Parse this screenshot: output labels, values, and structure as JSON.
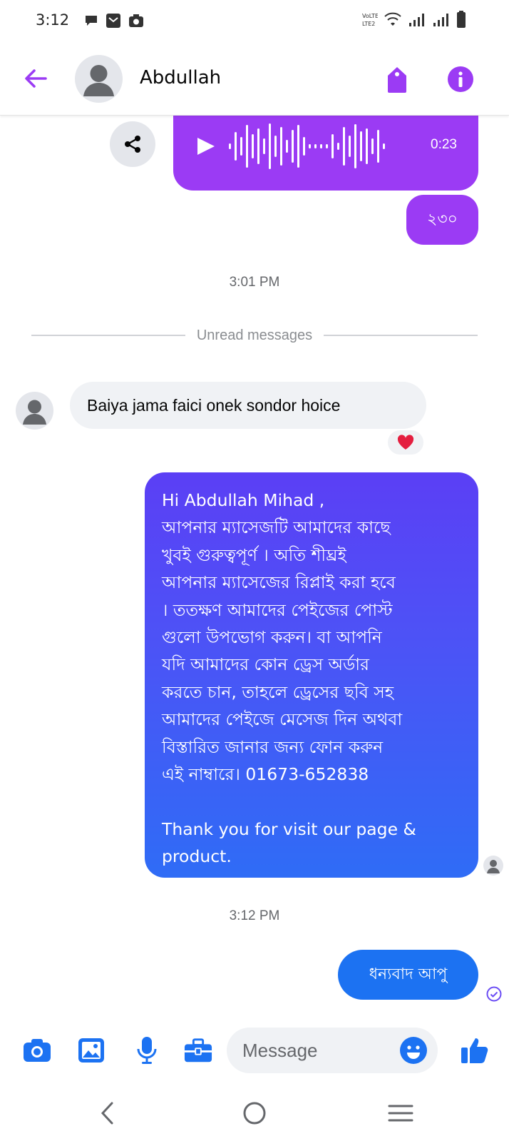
{
  "status_bar": {
    "time": "3:12"
  },
  "header": {
    "contact_name": "Abdullah"
  },
  "messages": {
    "audio": {
      "duration": "0:23"
    },
    "outgoing_short": "২৩০",
    "timestamp_1": "3:01 PM",
    "unread_label": "Unread messages",
    "incoming_text": "Baiya jama faici onek sondor hoice",
    "reaction": "❤️",
    "auto_reply_lines": [
      "Hi Abdullah Mihad ,",
      "আপনার ম্যাসেজটি আমাদের কাছে",
      "খুবই গুরুত্বপূর্ণ । অতি শীঘ্রই",
      "আপনার ম্যাসেজের রিপ্লাই করা হবে",
      "। ততক্ষণ আমাদের পেইজের পোস্ট",
      "গুলো উপভোগ করুন। বা আপনি",
      "যদি আমাদের কোন ড্রেস অর্ডার",
      "করতে চান, তাহলে ড্রেসের ছবি সহ",
      "আমাদের পেইজে মেসেজ দিন অথবা",
      "বিস্তারিত জানার জন্য ফোন করুন",
      "এই নাম্বারে। 01673-652838",
      "",
      "Thank you for visit our page &",
      "product."
    ],
    "timestamp_2": "3:12 PM",
    "outgoing_thanks": "ধন্যবাদ আপু"
  },
  "composer": {
    "placeholder": "Message"
  },
  "colors": {
    "accent_purple": "#9b3bf4",
    "messenger_blue": "#1c72f2",
    "input_bg": "#f0f2f5"
  },
  "icons": {
    "back": "arrow-left-icon",
    "tag": "tag-icon",
    "info": "info-icon",
    "share": "share-icon",
    "play": "play-icon",
    "camera": "camera-icon",
    "gallery": "image-icon",
    "mic": "microphone-icon",
    "briefcase": "briefcase-icon",
    "emoji": "emoji-icon",
    "like": "thumbs-up-icon"
  }
}
